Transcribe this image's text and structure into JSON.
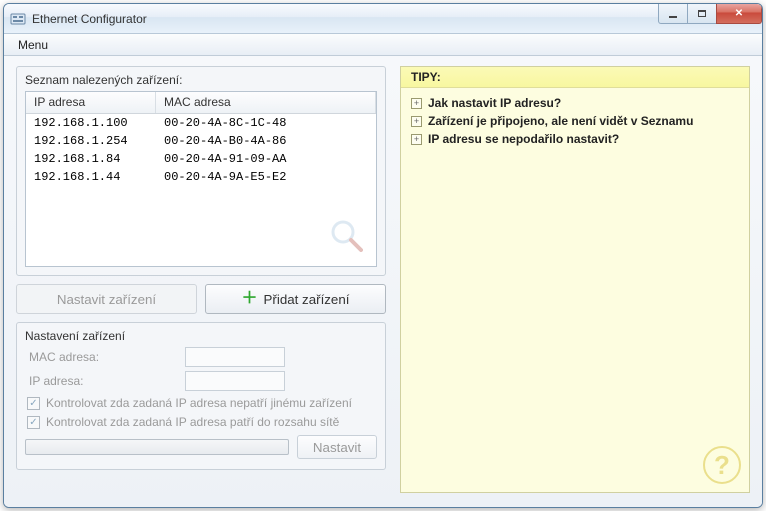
{
  "window": {
    "title": "Ethernet Configurator"
  },
  "menu": {
    "label": "Menu"
  },
  "device_list": {
    "group_title": "Seznam nalezených zařízení:",
    "col_ip": "IP adresa",
    "col_mac": "MAC adresa",
    "rows": [
      {
        "ip": "192.168.1.100",
        "mac": "00-20-4A-8C-1C-48"
      },
      {
        "ip": "192.168.1.254",
        "mac": "00-20-4A-B0-4A-86"
      },
      {
        "ip": "192.168.1.84",
        "mac": "00-20-4A-91-09-AA"
      },
      {
        "ip": "192.168.1.44",
        "mac": "00-20-4A-9A-E5-E2"
      }
    ]
  },
  "buttons": {
    "set_device": "Nastavit zařízení",
    "add_device": "Přidat zařízení"
  },
  "settings": {
    "group_title": "Nastavení zařízení",
    "mac_label": "MAC adresa:",
    "ip_label": "IP adresa:",
    "chk1": "Kontrolovat zda zadaná IP adresa nepatří jinému zařízení",
    "chk2": "Kontrolovat zda zadaná IP adresa patří do rozsahu sítě",
    "apply": "Nastavit"
  },
  "tips": {
    "title": "TIPY:",
    "items": [
      "Jak nastavit IP adresu?",
      "Zařízení je připojeno, ale není vidět v Seznamu",
      "IP adresu se nepodařilo nastavit?"
    ]
  }
}
